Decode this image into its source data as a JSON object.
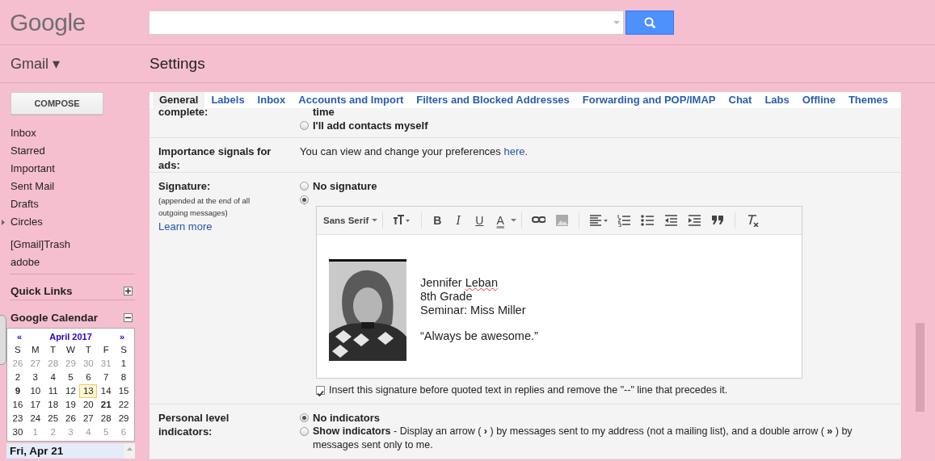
{
  "header": {
    "logo": "Google"
  },
  "app_menu": {
    "label": "Gmail",
    "caret": "▾"
  },
  "page_title": "Settings",
  "compose": "COMPOSE",
  "sidebar": {
    "items": [
      {
        "label": "Inbox",
        "kind": "label"
      },
      {
        "label": "Starred",
        "kind": "label"
      },
      {
        "label": "Important",
        "kind": "label"
      },
      {
        "label": "Sent Mail",
        "kind": "label"
      },
      {
        "label": "Drafts",
        "kind": "label"
      },
      {
        "label": "Circles",
        "kind": "group"
      }
    ],
    "labels": [
      {
        "label": "[Gmail]Trash"
      },
      {
        "label": "adobe"
      }
    ],
    "sections": [
      {
        "title": "Quick Links",
        "expanded": false
      },
      {
        "title": "Google Calendar",
        "expanded": true
      }
    ]
  },
  "calendar": {
    "prev": "«",
    "month": "April 2017",
    "next": "»",
    "weekdays": [
      "S",
      "M",
      "T",
      "W",
      "T",
      "F",
      "S"
    ],
    "weeks": [
      [
        {
          "d": "26",
          "muted": true
        },
        {
          "d": "27",
          "muted": true
        },
        {
          "d": "28",
          "muted": true
        },
        {
          "d": "29",
          "muted": true
        },
        {
          "d": "30",
          "muted": true
        },
        {
          "d": "31",
          "muted": true
        },
        {
          "d": "1",
          "muted": false
        }
      ],
      [
        {
          "d": "2",
          "muted": false
        },
        {
          "d": "3",
          "muted": false
        },
        {
          "d": "4",
          "muted": false
        },
        {
          "d": "5",
          "muted": false
        },
        {
          "d": "6",
          "muted": false
        },
        {
          "d": "7",
          "muted": false
        },
        {
          "d": "8",
          "muted": false
        }
      ],
      [
        {
          "d": "9",
          "muted": false,
          "bold": true
        },
        {
          "d": "10",
          "muted": false
        },
        {
          "d": "11",
          "muted": false
        },
        {
          "d": "12",
          "muted": false
        },
        {
          "d": "13",
          "muted": false,
          "today": true
        },
        {
          "d": "14",
          "muted": false
        },
        {
          "d": "15",
          "muted": false
        }
      ],
      [
        {
          "d": "16",
          "muted": false
        },
        {
          "d": "17",
          "muted": false
        },
        {
          "d": "18",
          "muted": false
        },
        {
          "d": "19",
          "muted": false
        },
        {
          "d": "20",
          "muted": false
        },
        {
          "d": "21",
          "muted": false,
          "bold": true
        },
        {
          "d": "22",
          "muted": false
        }
      ],
      [
        {
          "d": "23",
          "muted": false
        },
        {
          "d": "24",
          "muted": false
        },
        {
          "d": "25",
          "muted": false
        },
        {
          "d": "26",
          "muted": false
        },
        {
          "d": "27",
          "muted": false
        },
        {
          "d": "28",
          "muted": false
        },
        {
          "d": "29",
          "muted": false
        }
      ],
      [
        {
          "d": "30",
          "muted": false
        },
        {
          "d": "1",
          "muted": true
        },
        {
          "d": "2",
          "muted": true
        },
        {
          "d": "3",
          "muted": true
        },
        {
          "d": "4",
          "muted": true
        },
        {
          "d": "5",
          "muted": true
        },
        {
          "d": "6",
          "muted": true
        }
      ]
    ],
    "selected_date": "Fri, Apr 21"
  },
  "tabs": [
    {
      "label": "General",
      "selected": true
    },
    {
      "label": "Labels",
      "selected": false
    },
    {
      "label": "Inbox",
      "selected": false
    },
    {
      "label": "Accounts and Import",
      "selected": false
    },
    {
      "label": "Filters and Blocked Addresses",
      "selected": false
    },
    {
      "label": "Forwarding and POP/IMAP",
      "selected": false
    },
    {
      "label": "Chat",
      "selected": false
    },
    {
      "label": "Labs",
      "selected": false
    },
    {
      "label": "Offline",
      "selected": false
    },
    {
      "label": "Themes",
      "selected": false
    }
  ],
  "settings": [
    {
      "label": "complete:",
      "items": [
        {
          "kind": "text",
          "text": "time"
        },
        {
          "kind": "radio",
          "label": "I'll add contacts myself",
          "selected": false
        }
      ]
    },
    {
      "label": "Importance signals for ads:",
      "items": [
        {
          "kind": "link_text",
          "text": "You can view and change your preferences",
          "link": "here."
        }
      ]
    },
    {
      "label": "Signature:",
      "note": "(appended at the end of all outgoing messages)",
      "link": "Learn more",
      "items": [
        {
          "kind": "radio",
          "label": "No signature",
          "selected": false
        },
        {
          "kind": "editor",
          "selected": true,
          "font": "Sans Serif",
          "format_buttons": [
            {
              "kind": "bold",
              "glyph": "B"
            },
            {
              "kind": "italic",
              "glyph": "I"
            },
            {
              "kind": "underline",
              "glyph": "U"
            },
            {
              "kind": "color",
              "glyph": "A"
            }
          ],
          "photo": {
            "kind": "picture"
          },
          "lines": [
            "Jennifer Leban",
            "8th Grade",
            "Seminar: Miss Miller"
          ],
          "quote": "“Always be awesome.”"
        },
        {
          "kind": "checkbox",
          "label": "Insert this signature before quoted text in replies and remove the \"--\" line that precedes it.",
          "checked": true
        }
      ]
    },
    {
      "label": "Personal level indicators:",
      "items": [
        {
          "kind": "radio",
          "label": "No indicators",
          "selected": true
        },
        {
          "kind": "radio_desc",
          "label": "Show indicators",
          "desc": " - Display an arrow ( **›** ) by messages sent to my address (not a mailing list), and a double arrow ( **»** ) by messages sent only to me.",
          "selected": false
        }
      ]
    }
  ]
}
